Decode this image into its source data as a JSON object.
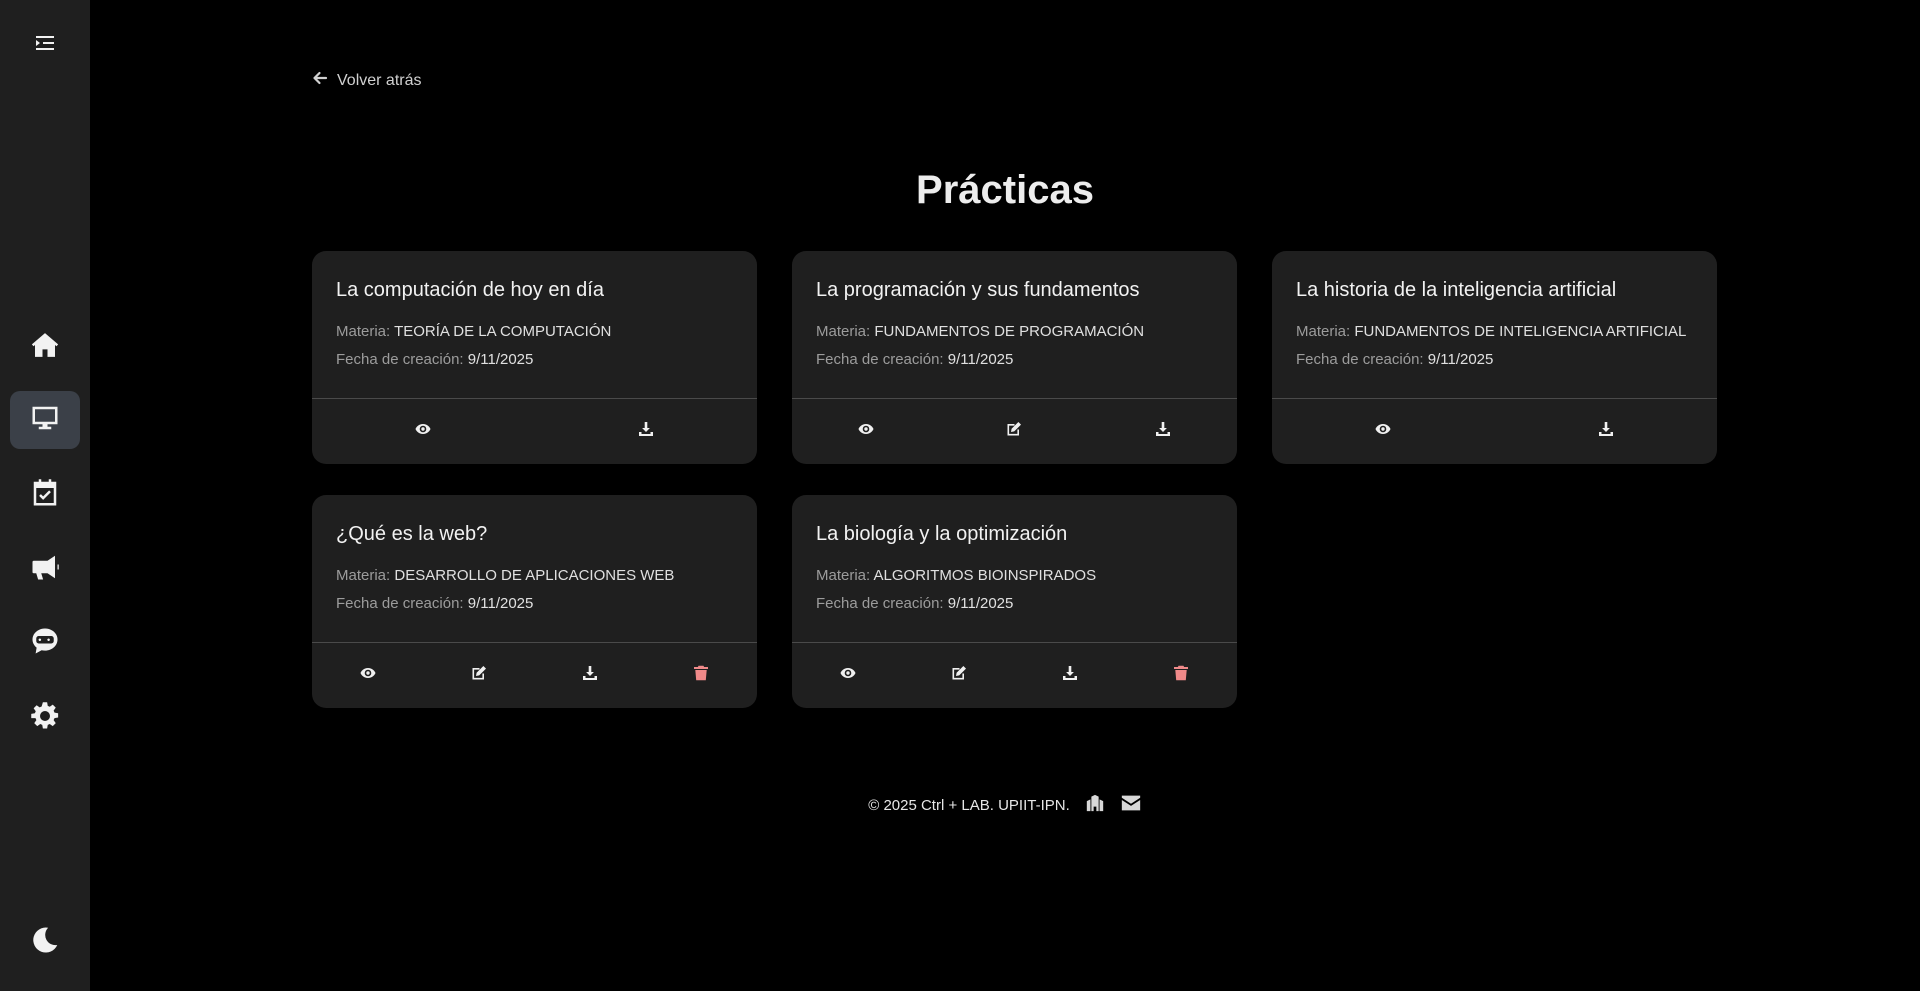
{
  "sidebar": {
    "items": [
      {
        "name": "menu-toggle",
        "icon": "menu-collapse-icon",
        "active": false
      },
      {
        "name": "home",
        "icon": "home-icon",
        "active": false
      },
      {
        "name": "practicas",
        "icon": "desktop-icon",
        "active": true
      },
      {
        "name": "calendar",
        "icon": "calendar-check-icon",
        "active": false
      },
      {
        "name": "announcements",
        "icon": "megaphone-icon",
        "active": false
      },
      {
        "name": "chatbot",
        "icon": "robot-chat-icon",
        "active": false
      },
      {
        "name": "settings",
        "icon": "gear-icon",
        "active": false
      },
      {
        "name": "theme-toggle",
        "icon": "moon-icon",
        "active": false
      }
    ]
  },
  "header": {
    "back_label": "Volver atrás",
    "title": "Prácticas"
  },
  "labels": {
    "materia": "Materia:",
    "fecha": "Fecha de creación:"
  },
  "cards": [
    {
      "title": "La computación de hoy en día",
      "materia": "TEORÍA DE LA COMPUTACIÓN",
      "fecha": "9/11/2025",
      "actions": [
        "view",
        "download"
      ]
    },
    {
      "title": "La programación y sus fundamentos",
      "materia": "FUNDAMENTOS DE PROGRAMACIÓN",
      "fecha": "9/11/2025",
      "actions": [
        "view",
        "edit",
        "download"
      ]
    },
    {
      "title": "La historia de la inteligencia artificial",
      "materia": "FUNDAMENTOS DE INTELIGENCIA ARTIFICIAL",
      "fecha": "9/11/2025",
      "actions": [
        "view",
        "download"
      ]
    },
    {
      "title": "¿Qué es la web?",
      "materia": "DESARROLLO DE APLICACIONES WEB",
      "fecha": "9/11/2025",
      "actions": [
        "view",
        "edit",
        "download",
        "delete"
      ]
    },
    {
      "title": "La biología y la optimización",
      "materia": "ALGORITMOS BIOINSPIRADOS",
      "fecha": "9/11/2025",
      "actions": [
        "view",
        "edit",
        "download",
        "delete"
      ]
    }
  ],
  "footer": {
    "copyright": "© 2025 Ctrl + LAB. UPIIT-IPN.",
    "icons": [
      "institution-icon",
      "envelope-icon"
    ]
  },
  "colors": {
    "background": "#000000",
    "sidebar": "#1f1f1f",
    "card": "#1f1f1f",
    "active_nav": "#3b4048",
    "delete": "#f08a8a"
  }
}
